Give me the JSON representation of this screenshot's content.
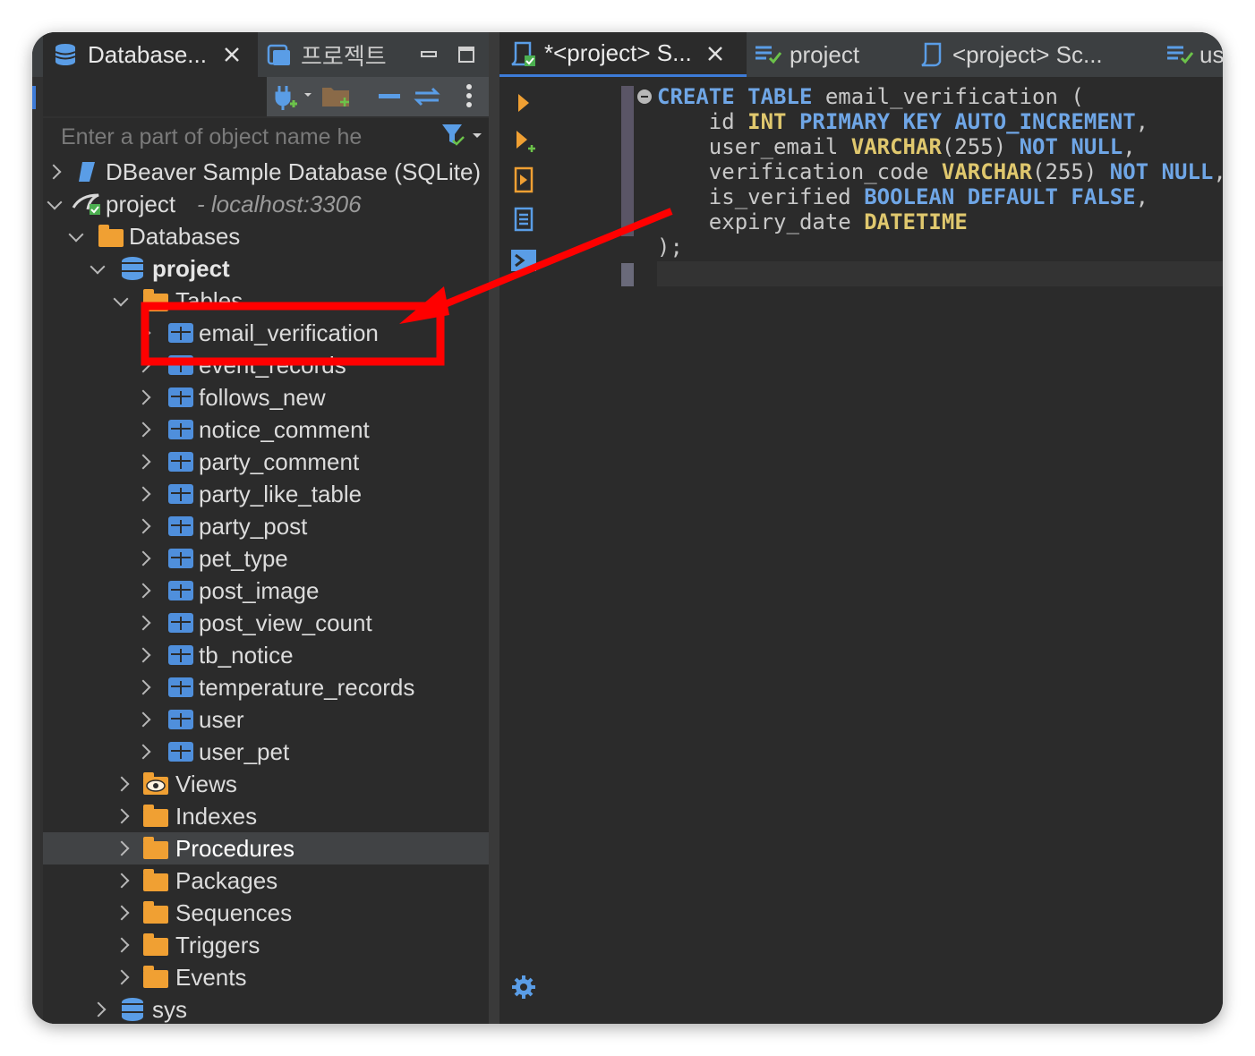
{
  "left_tabs": [
    {
      "label": "Database..."
    },
    {
      "label": "프로젝트"
    }
  ],
  "filter": {
    "placeholder": "Enter a part of object name he"
  },
  "tree": {
    "sample_db": "DBeaver Sample Database (SQLite)",
    "connection": {
      "label": "project",
      "host": "- localhost:3306"
    },
    "databases": "Databases",
    "schema": "project",
    "tables_folder": "Tables",
    "tables": [
      "email_verification",
      "event_records",
      "follows_new",
      "notice_comment",
      "party_comment",
      "party_like_table",
      "party_post",
      "pet_type",
      "post_image",
      "post_view_count",
      "tb_notice",
      "temperature_records",
      "user",
      "user_pet"
    ],
    "folders": [
      "Views",
      "Indexes",
      "Procedures",
      "Packages",
      "Sequences",
      "Triggers",
      "Events"
    ],
    "selected_folder": "Procedures",
    "sys_schema": "sys"
  },
  "right_tabs": [
    {
      "label": "*<project> S..."
    },
    {
      "label": "project"
    },
    {
      "label": "<project> Sc..."
    },
    {
      "label": "us"
    }
  ],
  "editor": {
    "lines": [
      [
        [
          "kw",
          "CREATE"
        ],
        [
          "t",
          " "
        ],
        [
          "kw",
          "TABLE"
        ],
        [
          "t",
          " email_verification ("
        ]
      ],
      [
        [
          "t",
          "    id "
        ],
        [
          "ty",
          "INT"
        ],
        [
          "t",
          " "
        ],
        [
          "kw",
          "PRIMARY KEY AUTO_INCREMENT"
        ],
        [
          "t",
          ","
        ]
      ],
      [
        [
          "t",
          "    user_email "
        ],
        [
          "ty",
          "VARCHAR"
        ],
        [
          "t",
          "(255) "
        ],
        [
          "kw",
          "NOT NULL"
        ],
        [
          "t",
          ","
        ]
      ],
      [
        [
          "t",
          "    verification_code "
        ],
        [
          "ty",
          "VARCHAR"
        ],
        [
          "t",
          "(255) "
        ],
        [
          "kw",
          "NOT NULL"
        ],
        [
          "t",
          ","
        ]
      ],
      [
        [
          "t",
          "    is_verified "
        ],
        [
          "kw",
          "BOOLEAN DEFAULT FALSE"
        ],
        [
          "t",
          ","
        ]
      ],
      [
        [
          "t",
          "    expiry_date "
        ],
        [
          "ty",
          "DATETIME"
        ]
      ],
      [
        [
          "t",
          ");"
        ]
      ]
    ]
  },
  "colors": {
    "highlight_box": "#ff0000",
    "keyword": "#6fa6e6",
    "type": "#e0c86e",
    "folder": "#f0a033",
    "table_icon": "#4f8fdc"
  },
  "icons": [
    "database-icon",
    "close-icon",
    "project-icon",
    "minimize-icon",
    "maximize-icon",
    "new-connection-icon",
    "new-folder-icon",
    "collapse-icon",
    "link-icon",
    "menu-icon",
    "filter-icon",
    "sql-editor-icon",
    "run-icon",
    "run-new-tab-icon",
    "execute-script-icon",
    "explain-plan-icon",
    "console-icon",
    "settings-icon"
  ]
}
